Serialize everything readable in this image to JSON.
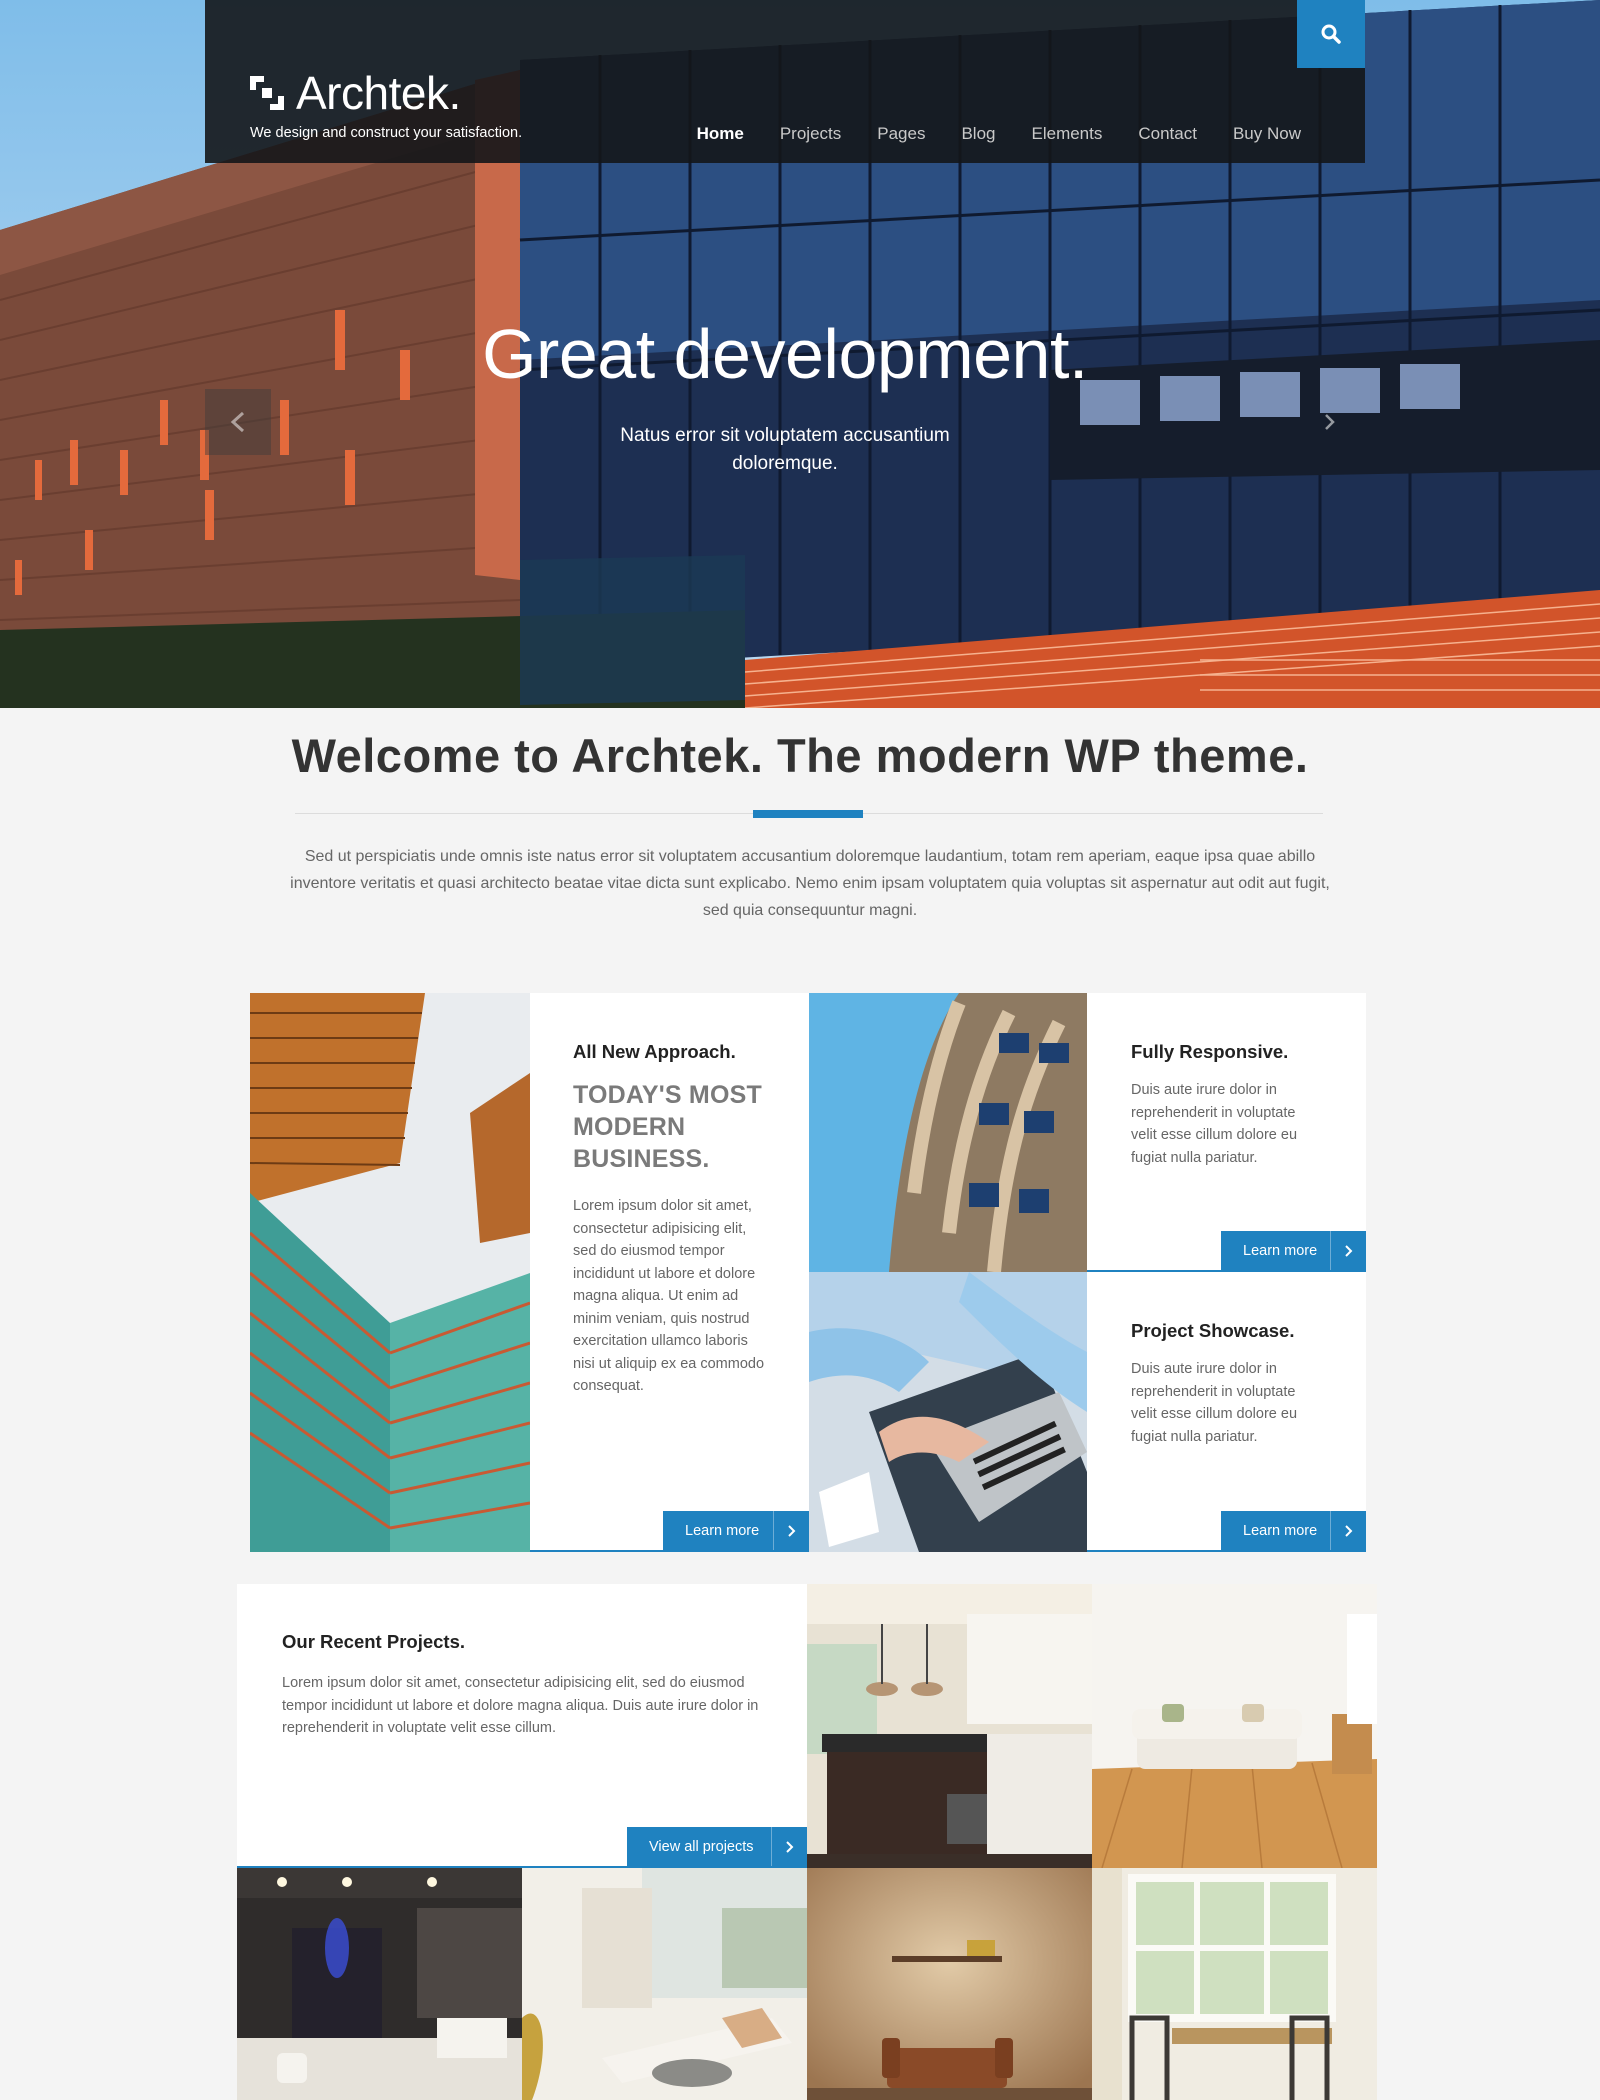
{
  "site": {
    "logo_text": "Archtek.",
    "tagline": "We design and construct your satisfaction."
  },
  "nav": [
    {
      "label": "Home",
      "active": true
    },
    {
      "label": "Projects"
    },
    {
      "label": "Pages"
    },
    {
      "label": "Blog"
    },
    {
      "label": "Elements"
    },
    {
      "label": "Contact"
    },
    {
      "label": "Buy Now"
    }
  ],
  "hero": {
    "title": "Great development.",
    "subtitle": "Natus error sit voluptatem accusantium doloremque."
  },
  "welcome": {
    "title_pre": "Welcome to ",
    "title_brand": "Archtek.",
    "title_post": " The modern WP theme.",
    "text": "Sed ut perspiciatis unde omnis iste natus error sit voluptatem accusantium doloremque laudantium, totam rem aperiam, eaque ipsa quae abillo inventore veritatis et quasi architecto beatae vitae dicta sunt explicabo. Nemo enim ipsam voluptatem quia voluptas sit aspernatur aut odit aut fugit, sed quia consequuntur magni."
  },
  "features": {
    "approach": {
      "title": "All New Approach.",
      "headline": "TODAY'S MOST MODERN BUSINESS.",
      "text": "Lorem ipsum dolor sit amet, consectetur adipisicing elit, sed do eiusmod tempor incididunt ut labore et dolore magna aliqua. Ut enim ad minim veniam, quis nostrud exercitation ullamco laboris nisi ut aliquip ex ea commodo consequat.",
      "button": "Learn more"
    },
    "responsive": {
      "title": "Fully Responsive.",
      "text": "Duis aute irure dolor in reprehenderit in voluptate velit esse cillum dolore eu fugiat nulla pariatur.",
      "button": "Learn more"
    },
    "showcase": {
      "title": "Project Showcase.",
      "text": "Duis aute irure dolor in reprehenderit in voluptate velit esse cillum dolore eu fugiat nulla pariatur.",
      "button": "Learn more"
    }
  },
  "projects": {
    "title": "Our Recent Projects.",
    "text": "Lorem ipsum dolor sit amet, consectetur adipisicing elit, sed do eiusmod tempor incididunt ut labore et dolore magna aliqua. Duis aute irure dolor in reprehenderit in voluptate velit esse cillum.",
    "button": "View all projects"
  },
  "colors": {
    "accent": "#1f82c0",
    "header_bg": "#14161a",
    "page_bg": "#f4f4f4"
  },
  "icons": [
    "search-icon",
    "chevron-left-icon",
    "chevron-right-icon",
    "logo-mark-icon"
  ]
}
